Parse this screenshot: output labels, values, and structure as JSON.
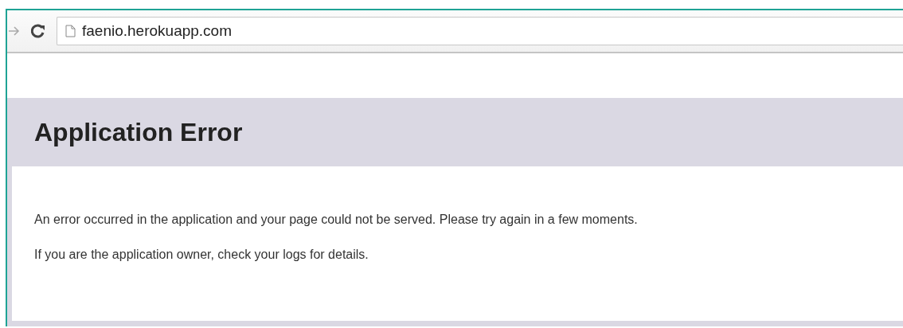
{
  "browser": {
    "address": "faenio.herokuapp.com"
  },
  "page": {
    "heading": "Application Error",
    "paragraphs": [
      "An error occurred in the application and your page could not be served. Please try again in a few moments.",
      "If you are the application owner, check your logs for details."
    ]
  }
}
